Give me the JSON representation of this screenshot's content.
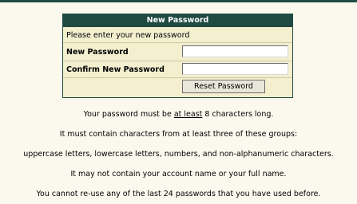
{
  "panel": {
    "title": "New Password",
    "prompt": "Please enter your new password",
    "new_password_label": "New Password",
    "new_password_value": "",
    "confirm_password_label": "Confirm New Password",
    "confirm_password_value": "",
    "reset_button_label": "Reset Password"
  },
  "rules": {
    "length_prefix": "Your password must be ",
    "length_emphasis": "at least",
    "length_suffix": " 8 characters long.",
    "groups_intro": "It must contain characters from at least three of these groups:",
    "groups_list": "uppercase letters, lowercase letters, numbers, and non-alphanumeric characters.",
    "no_name": "It may not contain your account name or your full name.",
    "no_reuse": "You cannot re-use any of the last 24 passwords that you have used before."
  },
  "colors": {
    "header_bg": "#1F4A41",
    "panel_bg": "#F3EFCF",
    "page_bg": "#FBF9EE"
  }
}
